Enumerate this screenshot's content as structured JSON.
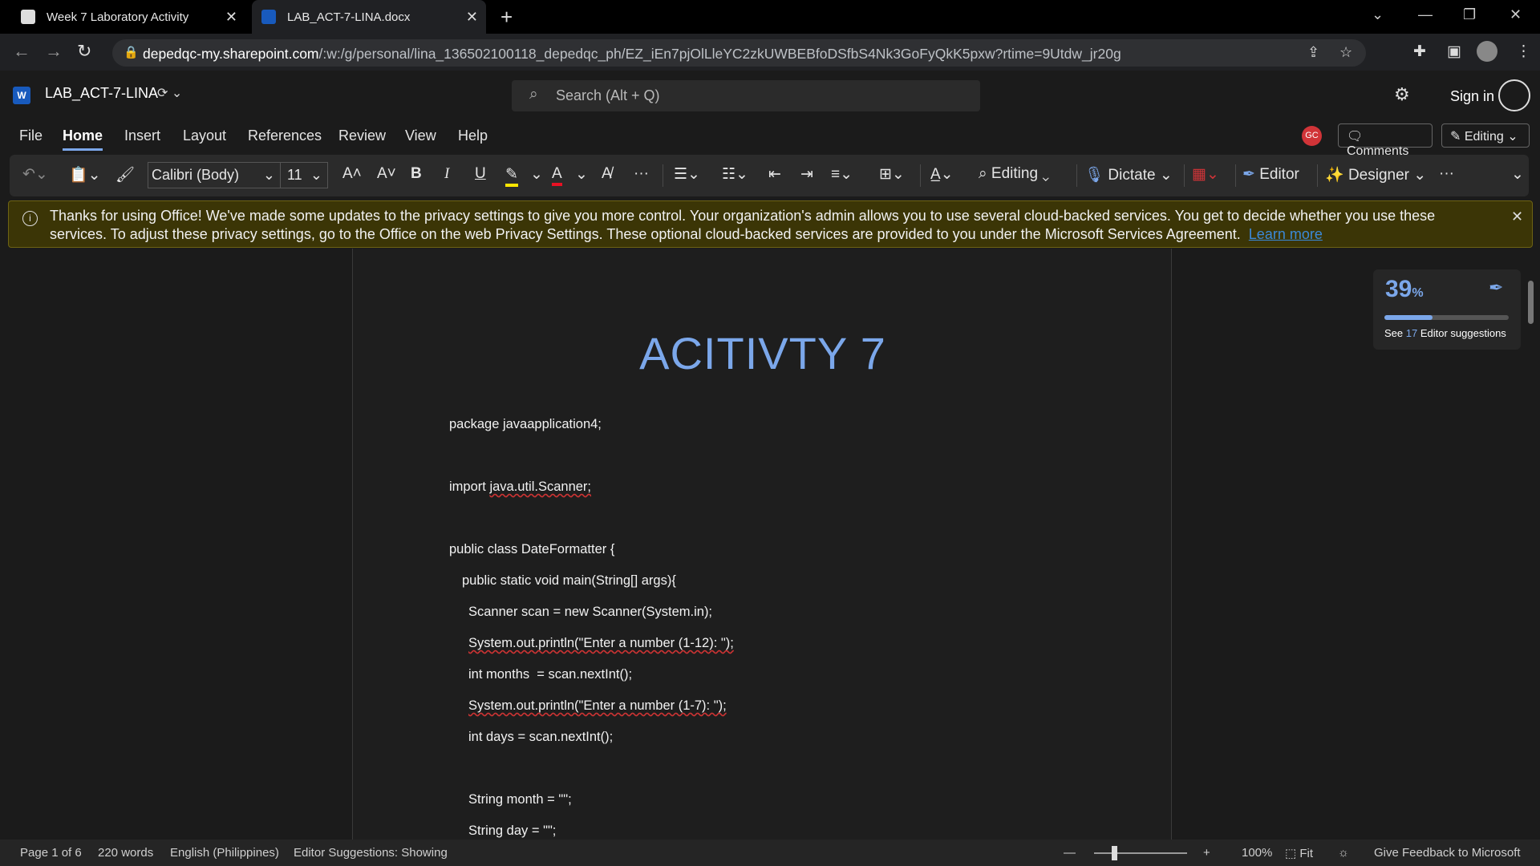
{
  "browser": {
    "tabs": [
      {
        "title": "Week 7 Laboratory Activity"
      },
      {
        "title": "LAB_ACT-7-LINA.docx"
      }
    ],
    "url_host": "depedqc-my.sharepoint.com",
    "url_path": "/:w:/g/personal/lina_136502100118_depedqc_ph/EZ_iEn7pjOlLleYC2zkUWBEBfoDSfbS4Nk3GoFyQkK5pxw?rtime=9Utdw_jr20g"
  },
  "word": {
    "filename": "LAB_ACT-7-LINA",
    "search_placeholder": "Search (Alt + Q)",
    "sign_in": "Sign in",
    "avatar_initials": "GC",
    "comments_label": "Comments",
    "editing_label": "Editing",
    "menu": [
      "File",
      "Home",
      "Insert",
      "Layout",
      "References",
      "Review",
      "View",
      "Help"
    ],
    "ribbon": {
      "font": "Calibri (Body)",
      "size": "11",
      "editing": "Editing",
      "dictate": "Dictate",
      "editor": "Editor",
      "designer": "Designer"
    }
  },
  "banner": {
    "message": "Thanks for using Office! We've made some updates to the privacy settings to give you more control. Your organization's admin allows you to use several cloud-backed services. You get to decide whether you use these services. To adjust these privacy settings, go to the Office on the web Privacy Settings. These optional cloud-backed services are provided to you under the Microsoft Services Agreement.",
    "link": "Learn more"
  },
  "document": {
    "title": "ACITIVTY 7",
    "lines": [
      "package javaapplication4;",
      "import java.util.Scanner;",
      "public class DateFormatter {",
      "public static void main(String[] args){",
      "Scanner scan = new Scanner(System.in);",
      "System.out.println(\"Enter a number (1-12): \");",
      "int months  = scan.nextInt();",
      "System.out.println(\"Enter a number (1-7): \");",
      "int days = scan.nextInt();",
      "String month = \"\";",
      "String day = \"\";"
    ]
  },
  "editor_card": {
    "score": "39",
    "score_unit": "%",
    "score_fraction": 0.39,
    "suggestions_prefix": "See",
    "suggestions_count": "17",
    "suggestions_suffix": "Editor suggestions"
  },
  "status": {
    "page": "Page 1 of 6",
    "words": "220 words",
    "language": "English (Philippines)",
    "editor": "Editor Suggestions: Showing",
    "zoom": "100%",
    "fit": "Fit",
    "feedback": "Give Feedback to Microsoft"
  },
  "colors": {
    "accent": "#7ba7ea",
    "banner_bg": "#3b3506",
    "word_blue": "#185abd",
    "avatar_red": "#d13438"
  }
}
